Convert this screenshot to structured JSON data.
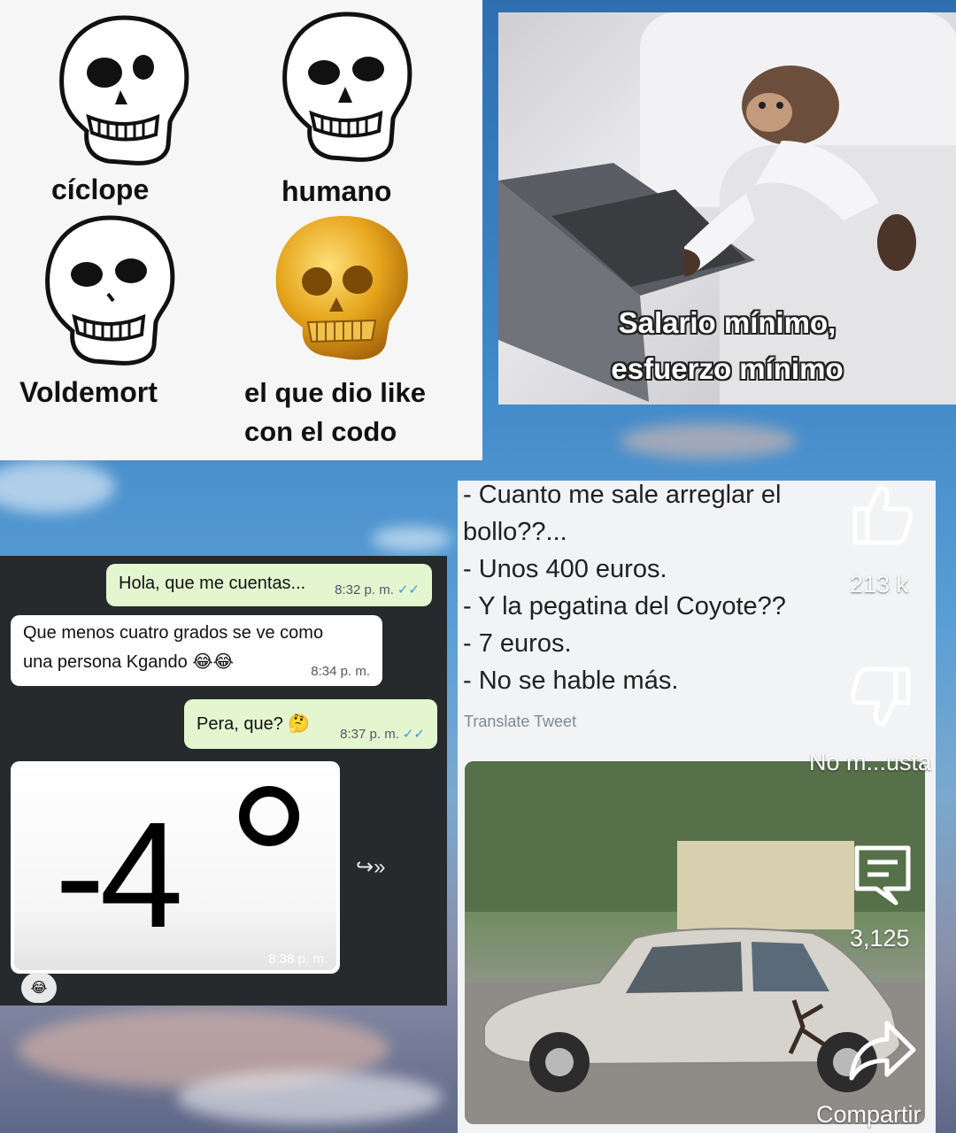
{
  "skull_meme": {
    "labels": [
      "cíclope",
      "humano",
      "Voldemort",
      "el que dio like",
      "con el codo"
    ],
    "colors": {
      "gold": "#e6a51c",
      "bone": "#ffffff",
      "ink": "#111111"
    }
  },
  "monkey_meme": {
    "caption_line1": "Salario mínimo,",
    "caption_line2": "esfuerzo mínimo"
  },
  "chat": {
    "messages": [
      {
        "text": "Hola, que me cuentas...",
        "time": "8:32 p. m.",
        "direction": "out",
        "ticks": "✓✓"
      },
      {
        "text_line1": "Que menos cuatro grados se ve como",
        "text_line2": "una persona Kgando 😂😂",
        "time": "8:34 p. m.",
        "direction": "in"
      },
      {
        "text": "Pera, que? 🤔",
        "time": "8:37 p. m.",
        "direction": "out",
        "ticks": "✓✓"
      },
      {
        "image_text": "-4",
        "time": "8:38 p. m.",
        "direction": "in"
      }
    ],
    "reaction": "😂",
    "forward_icon": "forward-arrow-icon"
  },
  "tweet": {
    "lines": [
      "- Cuanto me sale arreglar el",
      "bollo??...",
      "- Unos 400 euros.",
      "- Y la pegatina del Coyote??",
      "- 7 euros.",
      "- No se hable más."
    ],
    "translate_label": "Translate Tweet"
  },
  "rail": {
    "like_count": "213 k",
    "dislike_label": "No m...usta",
    "comment_count": "3,125",
    "share_label": "Compartir",
    "icons": [
      "thumbs-up-icon",
      "thumbs-down-icon",
      "comment-icon",
      "share-icon"
    ]
  }
}
